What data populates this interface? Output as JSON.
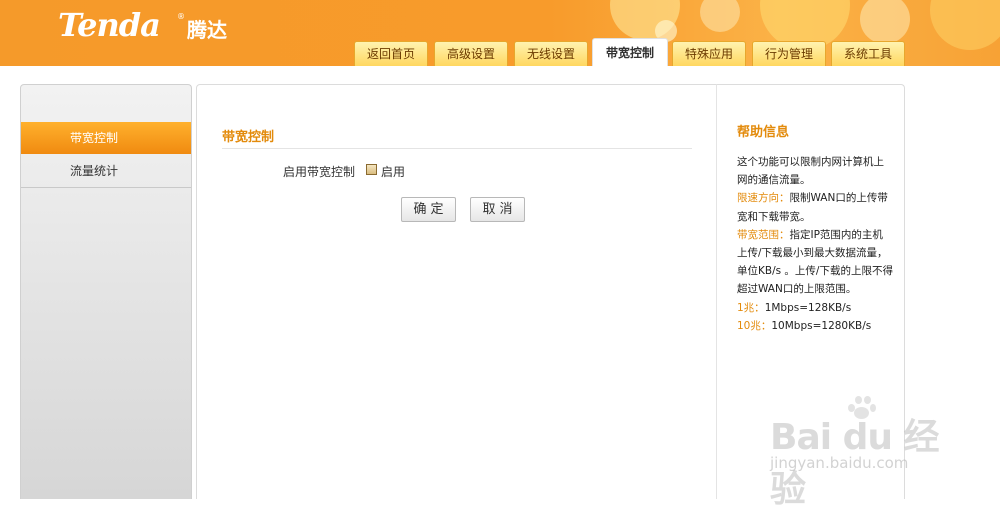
{
  "header": {
    "logo_text": "Tenda",
    "logo_cn": "腾达",
    "logo_mark": "®",
    "tabs": [
      {
        "label": "返回首页",
        "active": false
      },
      {
        "label": "高级设置",
        "active": false
      },
      {
        "label": "无线设置",
        "active": false
      },
      {
        "label": "带宽控制",
        "active": true
      },
      {
        "label": "特殊应用",
        "active": false
      },
      {
        "label": "行为管理",
        "active": false
      },
      {
        "label": "系统工具",
        "active": false
      }
    ]
  },
  "sidebar": {
    "items": [
      {
        "label": "带宽控制",
        "active": true
      },
      {
        "label": "流量统计",
        "active": false
      }
    ]
  },
  "main": {
    "section_title": "带宽控制",
    "enable_label": "启用带宽控制",
    "enable_checkbox_label": "启用",
    "enable_checked": false,
    "ok_button": "确定",
    "cancel_button": "取消"
  },
  "help": {
    "title": "帮助信息",
    "line1": "这个功能可以限制内网计算机上网的通信流量。",
    "dir_label": "限速方向：",
    "dir_text": "限制WAN口的上传带宽和下载带宽。",
    "range_label": "带宽范围：",
    "range_text": "指定IP范围内的主机上传/下载最小到最大数据流量，单位KB/s 。上传/下载的上限不得超过WAN口的上限范围。",
    "m1_label": "1兆：",
    "m1_text": "1Mbps=128KB/s",
    "m10_label": "10兆：",
    "m10_text": "10Mbps=1280KB/s"
  },
  "watermark": {
    "main": "Bai du 经验",
    "sub": "jingyan.baidu.com"
  },
  "colors": {
    "brand_orange": "#f89b2b",
    "accent_text": "#e38b0c",
    "tab_yellow": "#ffd760"
  }
}
